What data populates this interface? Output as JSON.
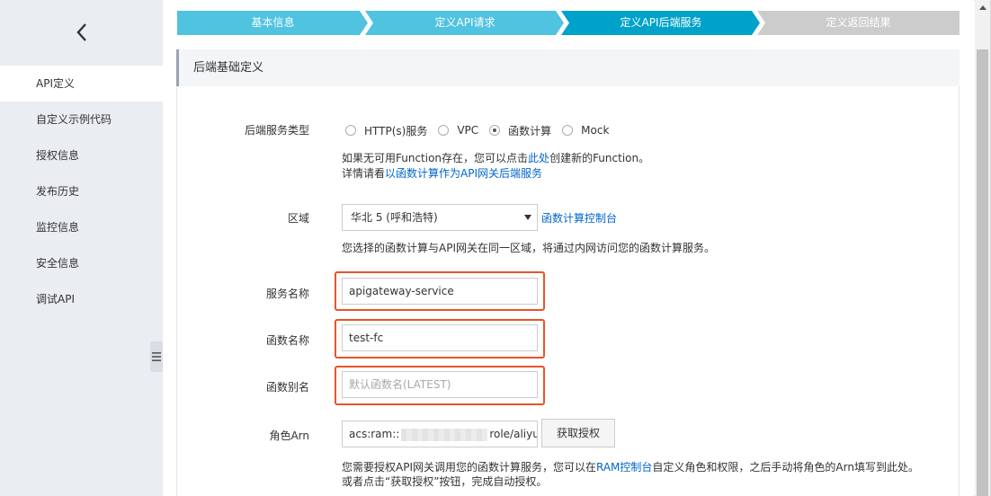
{
  "sidebar": {
    "back_icon": "chevron-left-icon",
    "items": [
      {
        "label": "API定义",
        "active": true
      },
      {
        "label": "自定义示例代码",
        "active": false
      },
      {
        "label": "授权信息",
        "active": false
      },
      {
        "label": "发布历史",
        "active": false
      },
      {
        "label": "监控信息",
        "active": false
      },
      {
        "label": "安全信息",
        "active": false
      },
      {
        "label": "调试API",
        "active": false
      }
    ],
    "collapse_icon": "collapse-handle-icon"
  },
  "steps": [
    {
      "label": "基本信息",
      "state": "done"
    },
    {
      "label": "定义API请求",
      "state": "done"
    },
    {
      "label": "定义API后端服务",
      "state": "current"
    },
    {
      "label": "定义返回结果",
      "state": "todo"
    }
  ],
  "section": {
    "title": "后端基础定义"
  },
  "form": {
    "backend_type": {
      "label": "后端服务类型",
      "options": [
        "HTTP(s)服务",
        "VPC",
        "函数计算",
        "Mock"
      ],
      "selected": "函数计算"
    },
    "fc_hint": {
      "line1_before": "如果无可用Function存在，您可以点击",
      "line1_link": "此处",
      "line1_after": "创建新的Function。",
      "line2_before": "详情请看",
      "line2_link": "以函数计算作为API网关后端服务"
    },
    "region": {
      "label": "区域",
      "value": "华北 5 (呼和浩特)",
      "console_link": "函数计算控制台",
      "hint": "您选择的函数计算与API网关在同一区域，将通过内网访问您的函数计算服务。"
    },
    "service_name": {
      "label": "服务名称",
      "value": "apigateway-service"
    },
    "function_name": {
      "label": "函数名称",
      "value": "test-fc"
    },
    "function_alias": {
      "label": "函数别名",
      "value": "",
      "placeholder": "默认函数名(LATEST)"
    },
    "role_arn": {
      "label": "角色Arn",
      "value_prefix": "acs:ram::",
      "value_suffix": "role/aliyu",
      "button_label": "获取授权",
      "hint_line1_before": "您需要授权API网关调用您的函数计算服务，您可以在",
      "hint_line1_link": "RAM控制台",
      "hint_line1_after": "自定义角色和权限，之后手动将角色的Arn填写到此处。",
      "hint_line2": "或者点击“获取授权”按钮，完成自动授权。"
    }
  },
  "colors": {
    "step_done": "#4fc3e0",
    "step_current": "#00a2ca",
    "step_todo": "#cccccc",
    "link": "#0066cc",
    "highlight": "#e8542a",
    "sidebar_bg": "#eaedf1"
  }
}
